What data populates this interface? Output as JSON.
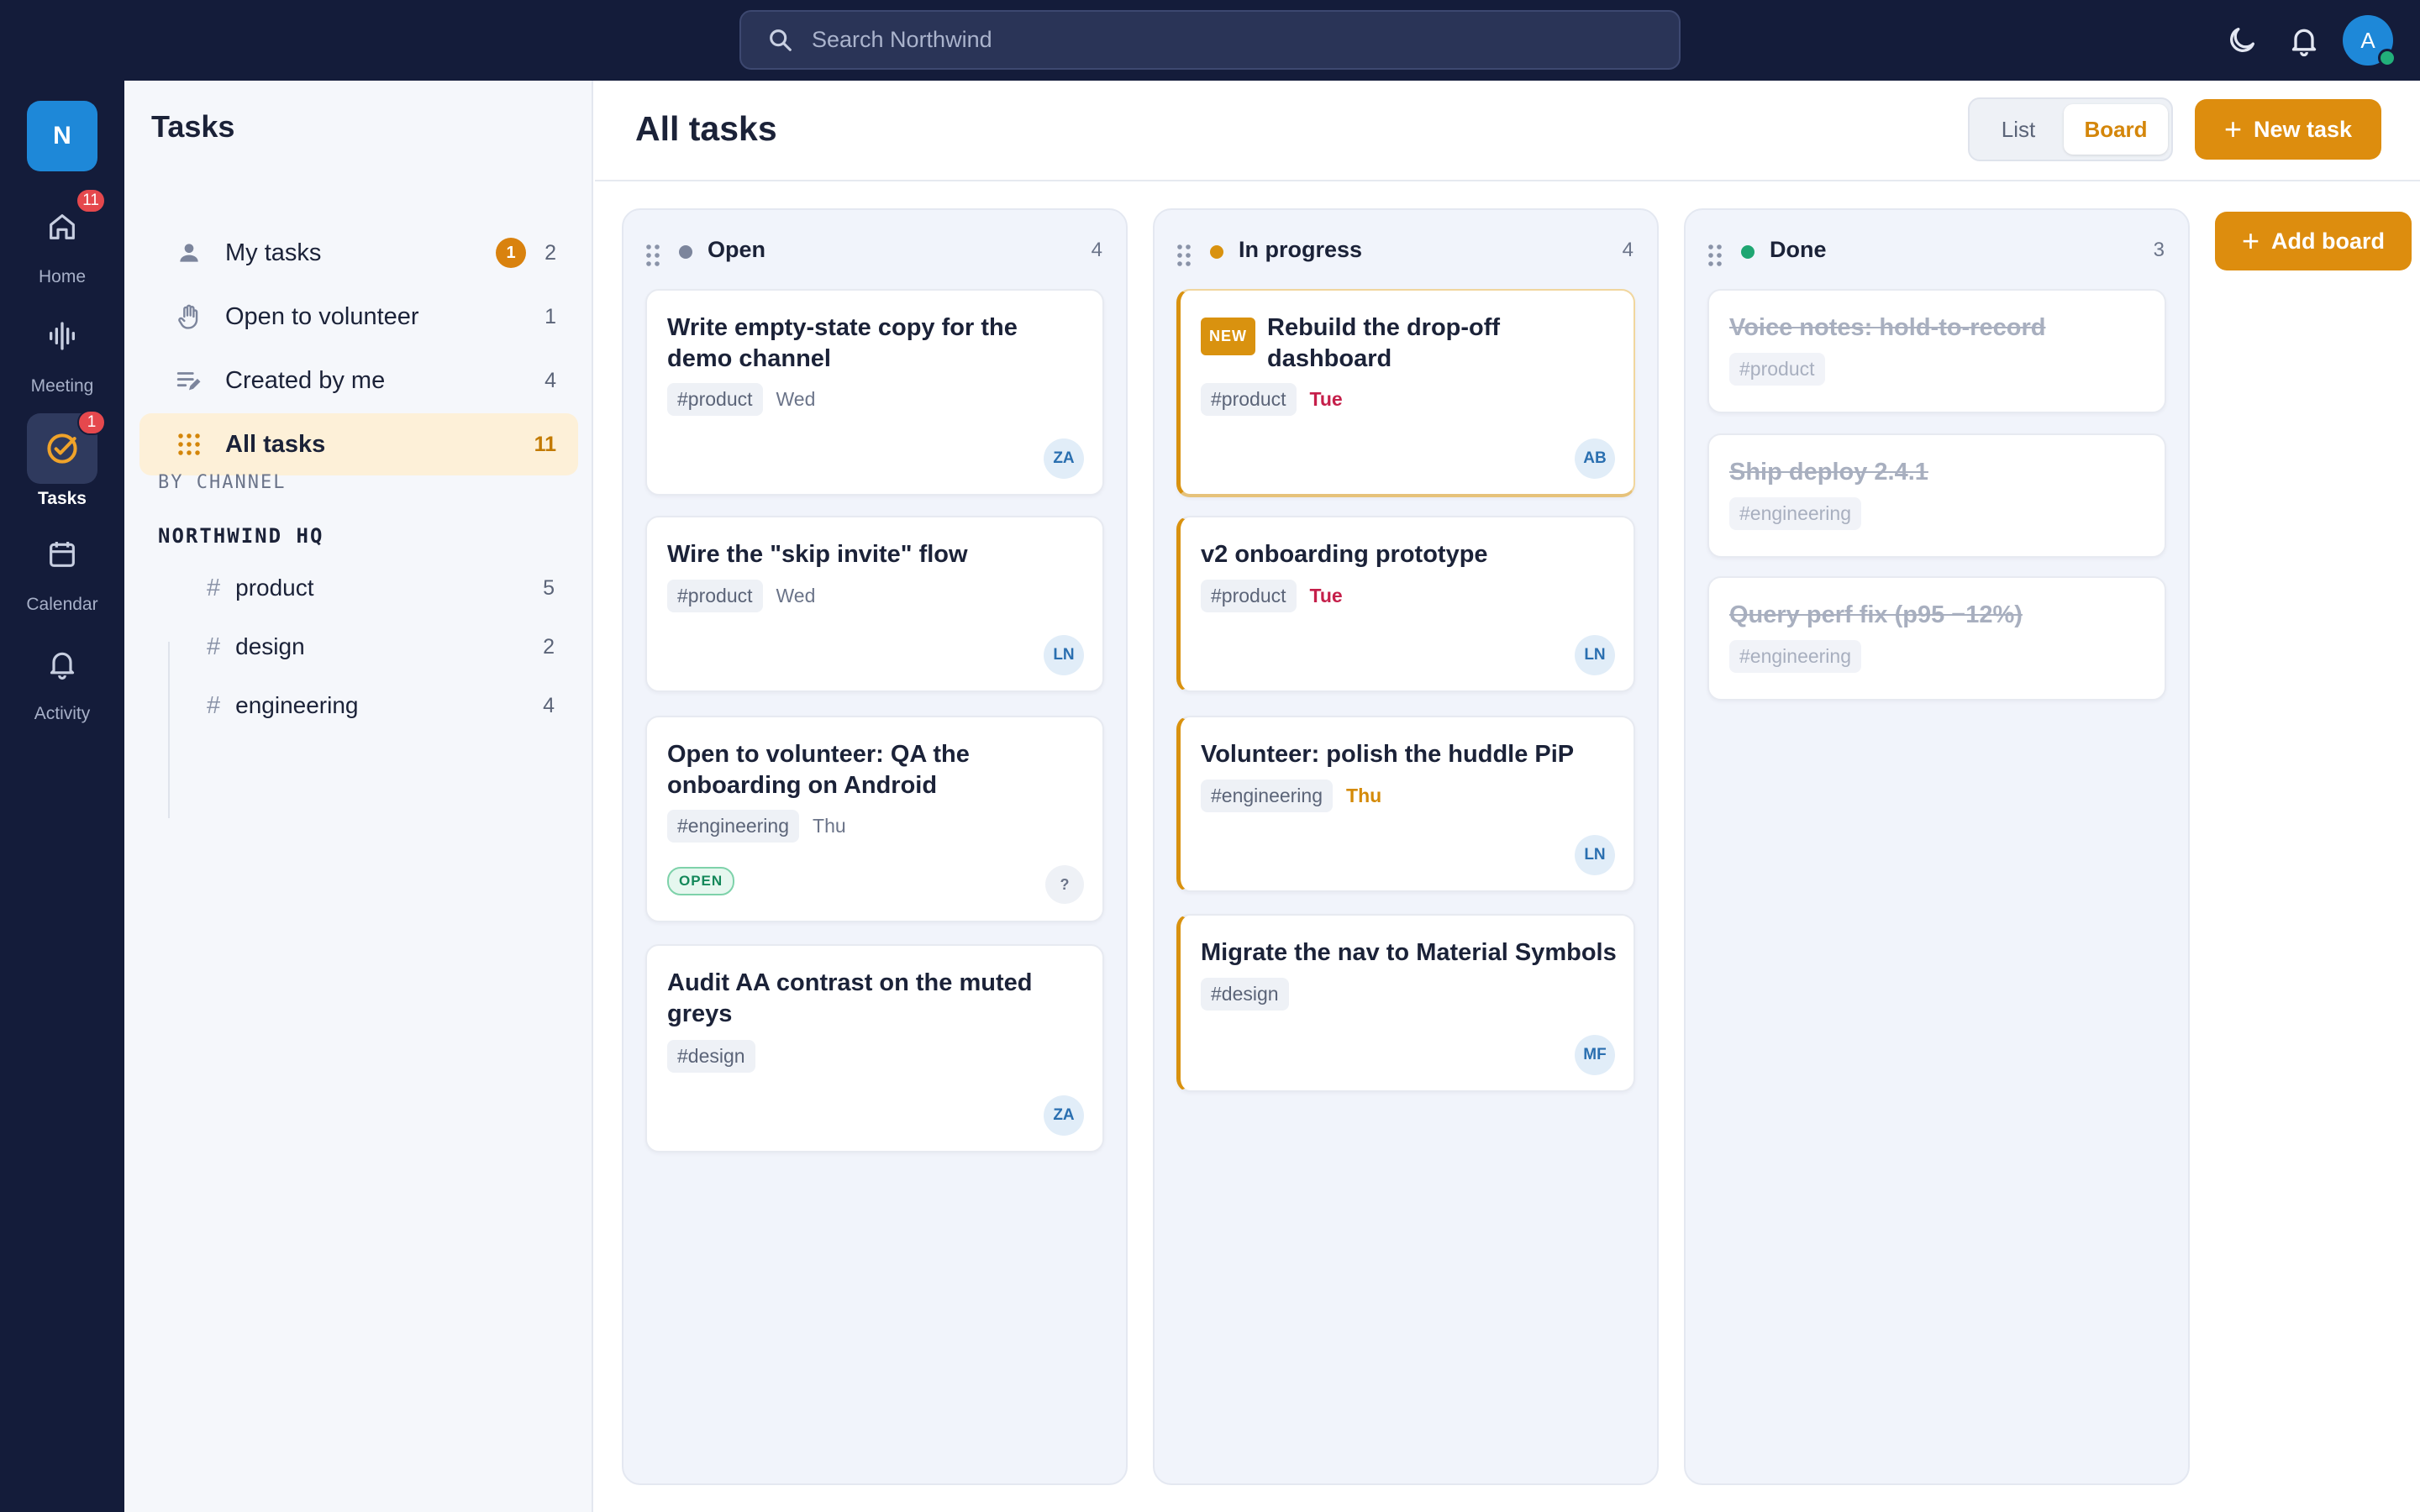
{
  "top": {
    "search_placeholder": "Search Northwind",
    "user_initial": "A"
  },
  "rail": {
    "workspace_initial": "N",
    "items": [
      {
        "label": "Home",
        "badge": "11"
      },
      {
        "label": "Meeting",
        "badge": ""
      },
      {
        "label": "Tasks",
        "badge": "1"
      },
      {
        "label": "Calendar",
        "badge": ""
      },
      {
        "label": "Activity",
        "badge": ""
      }
    ]
  },
  "sidebar": {
    "title": "Tasks",
    "items": [
      {
        "label": "My tasks",
        "badge": "1",
        "count": "2"
      },
      {
        "label": "Open to volunteer",
        "count": "1"
      },
      {
        "label": "Created by me",
        "count": "4"
      },
      {
        "label": "All tasks",
        "count": "11"
      }
    ],
    "by_channel_label": "BY CHANNEL",
    "workspace_label": "NORTHWIND HQ",
    "channels": [
      {
        "name": "product",
        "count": "5"
      },
      {
        "name": "design",
        "count": "2"
      },
      {
        "name": "engineering",
        "count": "4"
      }
    ]
  },
  "main": {
    "title": "All tasks",
    "view_list": "List",
    "view_board": "Board",
    "new_task": "New task",
    "add_board": "Add board"
  },
  "columns": [
    {
      "name": "Open",
      "count": "4",
      "dot_color": "#7c859c",
      "cards": [
        {
          "title": "Write empty-state copy for the demo channel",
          "tag": "#product",
          "due": "Wed",
          "assignee": "ZA"
        },
        {
          "title": "Wire the \"skip invite\" flow",
          "tag": "#product",
          "due": "Wed",
          "assignee": "LN"
        },
        {
          "title": "Open to volunteer: QA the onboarding on Android",
          "tag": "#engineering",
          "due": "Thu",
          "status_pill": "OPEN",
          "assignee": "?"
        },
        {
          "title": "Audit AA contrast on the muted greys",
          "tag": "#design",
          "assignee": "ZA"
        }
      ]
    },
    {
      "name": "In progress",
      "count": "4",
      "dot_color": "#d9920f",
      "cards": [
        {
          "badge": "NEW",
          "title": "Rebuild the drop-off dashboard",
          "tag": "#product",
          "due": "Tue",
          "assignee": "AB"
        },
        {
          "title": "v2 onboarding prototype",
          "tag": "#product",
          "due": "Tue",
          "assignee": "LN"
        },
        {
          "title": "Volunteer: polish the huddle PiP",
          "tag": "#engineering",
          "due": "Thu",
          "assignee": "LN"
        },
        {
          "title": "Migrate the nav to Material Symbols",
          "tag": "#design",
          "assignee": "MF"
        }
      ]
    },
    {
      "name": "Done",
      "count": "3",
      "dot_color": "#1fa672",
      "cards": [
        {
          "title": "Voice notes: hold-to-record",
          "tag": "#product"
        },
        {
          "title": "Ship deploy 2.4.1",
          "tag": "#engineering"
        },
        {
          "title": "Query perf fix (p95 −12%)",
          "tag": "#engineering"
        }
      ]
    }
  ],
  "colors": {
    "accent": "#dd8d0e",
    "nav_bg": "#141c3a",
    "due_red": "#c51f4a",
    "due_amber": "#d48a07"
  }
}
